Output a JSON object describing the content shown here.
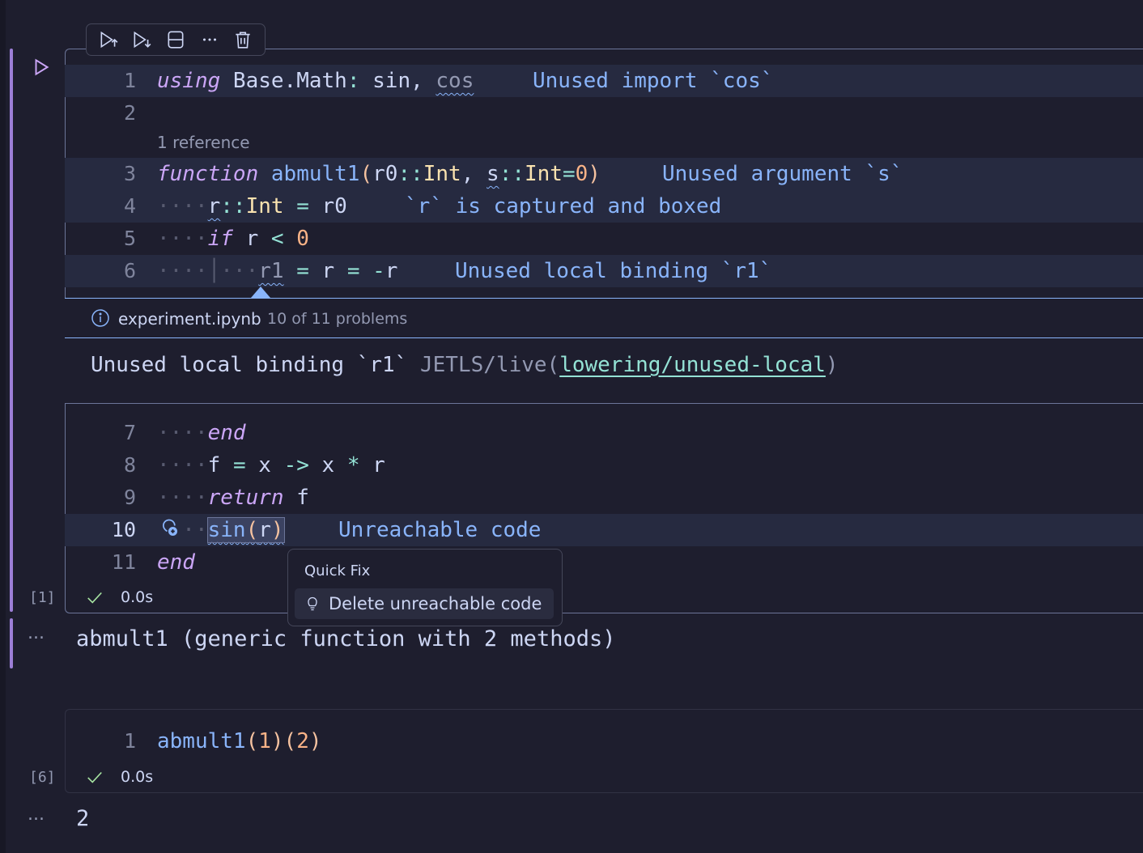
{
  "toolbar": {
    "icons": [
      "run-above-icon",
      "run-below-icon",
      "split-cell-icon",
      "more-icon",
      "delete-icon"
    ]
  },
  "cell1": {
    "execution_count": "[1]",
    "exec_time": "0.0s",
    "codelens": "1 reference",
    "lines": {
      "l1": {
        "num": "1",
        "code": "using Base.Math: sin, cos",
        "hint": "Unused import `cos`"
      },
      "l2": {
        "num": "2"
      },
      "l3": {
        "num": "3",
        "hint": "Unused argument `s`"
      },
      "l4": {
        "num": "4",
        "hint": "`r` is captured and boxed"
      },
      "l5": {
        "num": "5"
      },
      "l6": {
        "num": "6",
        "hint": "Unused local binding `r1`"
      },
      "l7": {
        "num": "7"
      },
      "l8": {
        "num": "8"
      },
      "l9": {
        "num": "9"
      },
      "l10": {
        "num": "10",
        "hint": "Unreachable code"
      },
      "l11": {
        "num": "11"
      }
    },
    "peek": {
      "file": "experiment.ipynb",
      "count": "10 of 11 problems",
      "message": "Unused local binding `r1`",
      "source": "JETLS/live(",
      "code_link": "lowering/unused-local",
      "source_end": ")"
    },
    "quickfix": {
      "title": "Quick Fix",
      "action": "Delete unreachable code"
    },
    "output_prefix": "...",
    "output": "abmult1 (generic function with 2 methods)"
  },
  "cell2": {
    "execution_count": "[6]",
    "exec_time": "0.0s",
    "line_num": "1",
    "output_prefix": "...",
    "output": "2"
  },
  "colors": {
    "background": "#1e1e2e",
    "keyword": "#cba6f7",
    "function": "#89b4fa",
    "type": "#f9e2af",
    "number": "#fab387",
    "operator": "#94e2d5",
    "cell_bar": "#9c7ed6",
    "success": "#a6e3a1"
  }
}
